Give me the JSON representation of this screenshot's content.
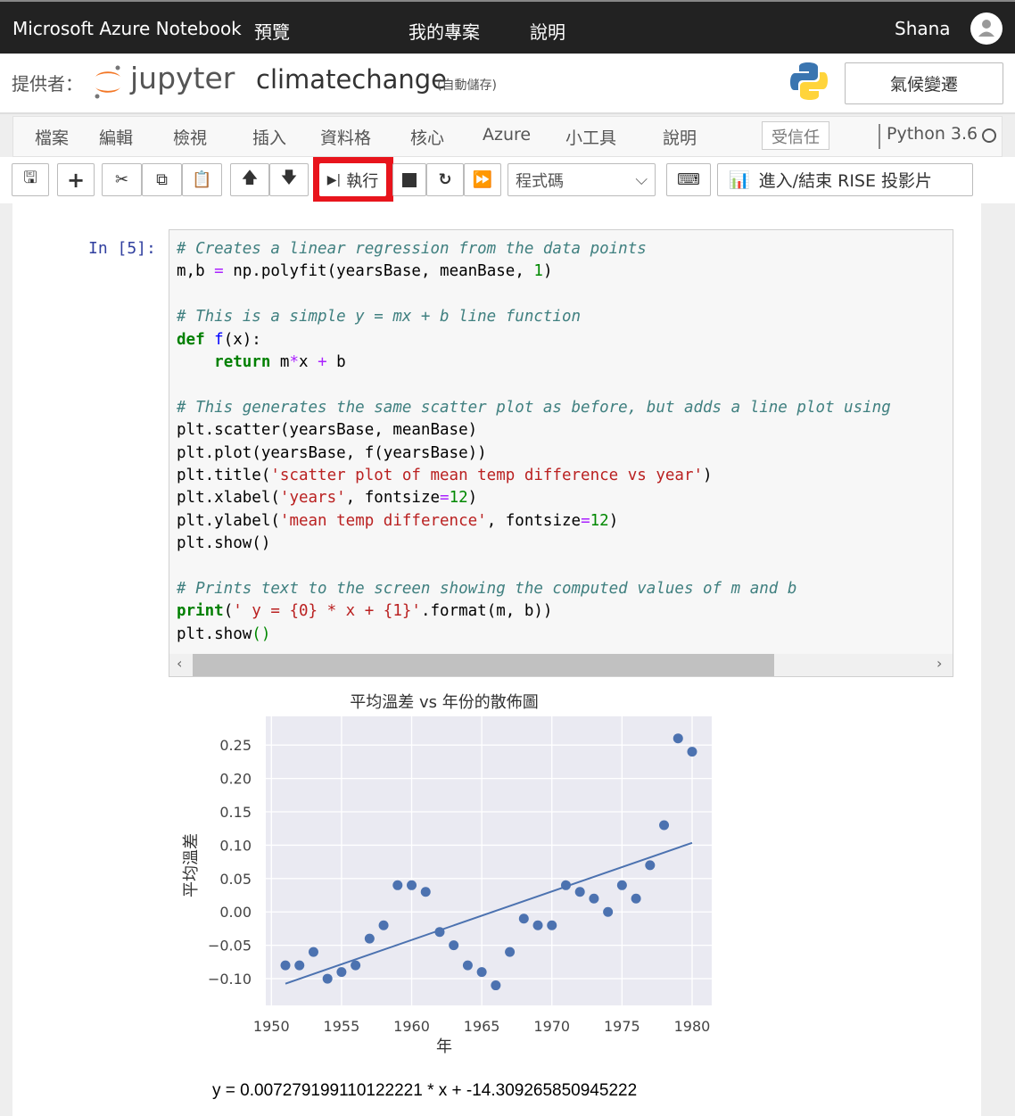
{
  "topnav": {
    "brand": "Microsoft Azure Notebook",
    "preview": "預覽",
    "my_projects": "我的專案",
    "help": "說明",
    "user": "Shana"
  },
  "header": {
    "provided_by": "提供者：",
    "logo_text": "jupyter",
    "notebook_name": "climatechange",
    "autosave": "(自動儲存)",
    "kernel_button": "氣候變遷"
  },
  "menu": {
    "items": [
      "檔案",
      "編輯",
      "檢視",
      "插入",
      "資料格",
      "核心",
      "Azure",
      "小工具",
      "說明"
    ],
    "trusted": "受信任",
    "kernel": "Python 3.6"
  },
  "toolbar": {
    "run_label": "執行",
    "cell_type": "程式碼",
    "rise_label": "進入/結束 RISE 投影片",
    "highlight_color": "#e8141c"
  },
  "cell": {
    "prompt": "In [5]:",
    "lines": [
      [
        [
          "# Creates a linear regression from the data points",
          "c"
        ]
      ],
      [
        [
          "m,b ",
          ""
        ],
        [
          "=",
          "o"
        ],
        [
          " np.polyfit(yearsBase, meanBase, ",
          ""
        ],
        [
          "1",
          "n"
        ],
        [
          ")",
          ""
        ]
      ],
      [],
      [
        [
          "# This is a simple y = mx + b line function",
          "c"
        ]
      ],
      [
        [
          "def",
          "k"
        ],
        [
          " ",
          ""
        ],
        [
          "f",
          "f"
        ],
        [
          "(x):",
          ""
        ]
      ],
      [
        [
          "    ",
          ""
        ],
        [
          "return",
          "k"
        ],
        [
          " m",
          ""
        ],
        [
          "*",
          "o"
        ],
        [
          "x ",
          ""
        ],
        [
          "+",
          "o"
        ],
        [
          " b",
          ""
        ]
      ],
      [],
      [
        [
          "# This generates the same scatter plot as before, but adds a line plot using",
          "c"
        ]
      ],
      [
        [
          "plt.scatter(yearsBase, meanBase)",
          ""
        ]
      ],
      [
        [
          "plt.plot(yearsBase, f(yearsBase))",
          ""
        ]
      ],
      [
        [
          "plt.title(",
          ""
        ],
        [
          "'scatter plot of mean temp difference vs year'",
          "s"
        ],
        [
          ")",
          ""
        ]
      ],
      [
        [
          "plt.xlabel(",
          ""
        ],
        [
          "'years'",
          "s"
        ],
        [
          ", fontsize",
          ""
        ],
        [
          "=",
          "o"
        ],
        [
          "12",
          "n"
        ],
        [
          ")",
          ""
        ]
      ],
      [
        [
          "plt.ylabel(",
          ""
        ],
        [
          "'mean temp difference'",
          "s"
        ],
        [
          ", fontsize",
          ""
        ],
        [
          "=",
          "o"
        ],
        [
          "12",
          "n"
        ],
        [
          ")",
          ""
        ]
      ],
      [
        [
          "plt.show()",
          ""
        ]
      ],
      [],
      [
        [
          "# Prints text to the screen showing the computed values of m and b",
          "c"
        ]
      ],
      [
        [
          "print",
          "k"
        ],
        [
          "(",
          ""
        ],
        [
          "' y = {0} * x + {1}'",
          "s"
        ],
        [
          ".format(m, b))",
          ""
        ]
      ],
      [
        [
          "plt.show",
          ""
        ],
        [
          "()",
          "n"
        ]
      ]
    ]
  },
  "chart_data": {
    "type": "scatter",
    "title": "平均溫差 vs 年份的散佈圖",
    "xlabel": "年",
    "ylabel": "平均溫差",
    "xlim": [
      1949.6,
      1981.4
    ],
    "ylim": [
      -0.14,
      0.293
    ],
    "xticks": [
      1950,
      1955,
      1960,
      1965,
      1970,
      1975,
      1980
    ],
    "yticks": [
      0.25,
      0.2,
      0.15,
      0.1,
      0.05,
      0.0,
      -0.05,
      -0.1
    ],
    "ytick_labels": [
      "0.25",
      "0.20",
      "0.15",
      "0.10",
      "0.05",
      "0.00",
      "−0.05",
      "−0.10"
    ],
    "grid": true,
    "point_color": "#4c72b0",
    "line_color": "#4c72b0",
    "background": "#eaeaf2",
    "x": [
      1951,
      1952,
      1953,
      1954,
      1955,
      1956,
      1957,
      1958,
      1959,
      1960,
      1961,
      1962,
      1963,
      1964,
      1965,
      1966,
      1967,
      1968,
      1969,
      1970,
      1971,
      1972,
      1973,
      1974,
      1975,
      1976,
      1977,
      1978,
      1979,
      1980
    ],
    "y": [
      -0.08,
      -0.08,
      -0.06,
      -0.1,
      -0.09,
      -0.08,
      -0.04,
      -0.02,
      0.04,
      0.04,
      0.03,
      -0.03,
      -0.05,
      -0.08,
      -0.09,
      -0.11,
      -0.06,
      -0.01,
      -0.02,
      -0.02,
      0.04,
      0.03,
      0.02,
      0.0,
      0.04,
      0.02,
      0.07,
      0.13,
      0.26,
      0.24
    ],
    "fit": {
      "m": 0.007279199110122221,
      "b": -14.309265850945222
    }
  },
  "output": {
    "text": "y = 0.007279199110122221 * x + -14.309265850945222"
  }
}
